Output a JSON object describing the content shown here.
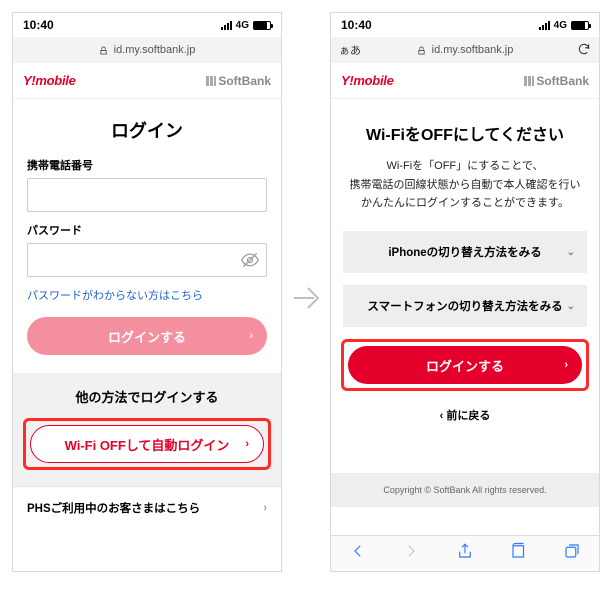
{
  "status": {
    "time": "10:40",
    "network": "4G"
  },
  "address": {
    "host": "id.my.softbank.jp",
    "aa": "ぁあ"
  },
  "brand": {
    "ymobile": "Y!mobile",
    "softbank": "SoftBank"
  },
  "left": {
    "title": "ログイン",
    "phone_label": "携帯電話番号",
    "password_label": "パスワード",
    "forgot": "パスワードがわからない方はこちら",
    "login_btn": "ログインする",
    "alt_title": "他の方法でログインする",
    "wifi_off_btn": "Wi-Fi OFFして自動ログイン",
    "phs_link": "PHSご利用中のお客さまはこちら"
  },
  "right": {
    "title": "Wi-FiをOFFにしてください",
    "desc1": "Wi-Fiを「OFF」にすることで、",
    "desc2": "携帯電話の回線状態から自動で本人確認を行い",
    "desc3": "かんたんにログインすることができます。",
    "acc_iphone": "iPhoneの切り替え方法をみる",
    "acc_sp": "スマートフォンの切り替え方法をみる",
    "login_btn": "ログインする",
    "back": "‹ 前に戻る",
    "copyright": "Copyright © SoftBank All rights reserved."
  }
}
